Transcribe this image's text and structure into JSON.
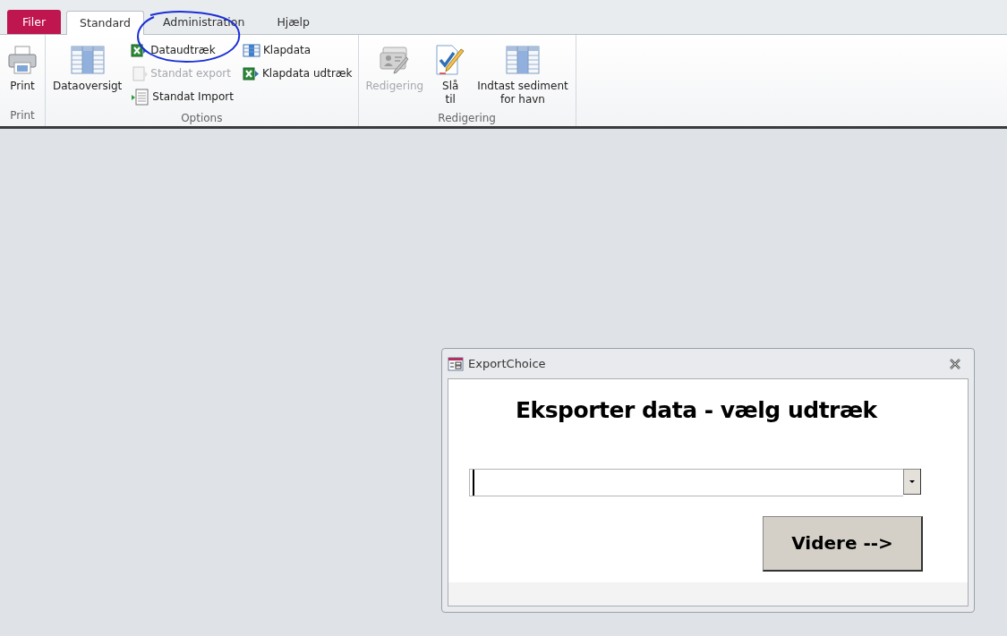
{
  "tabs": [
    {
      "label": "Filer",
      "kind": "file",
      "selected": false
    },
    {
      "label": "Standard",
      "kind": "tab",
      "selected": true
    },
    {
      "label": "Administration",
      "kind": "tab",
      "selected": false
    },
    {
      "label": "Hjælp",
      "kind": "tab",
      "selected": false
    }
  ],
  "ribbon_groups": [
    {
      "label": "Print",
      "items": [
        {
          "label": "Print",
          "kind": "large",
          "disabled": false
        }
      ]
    },
    {
      "label": "Options",
      "items": [
        {
          "label": "Dataoversigt",
          "kind": "large",
          "disabled": false
        },
        {
          "label": "Dataudtræk",
          "kind": "small",
          "disabled": false
        },
        {
          "label": "Standat export",
          "kind": "small",
          "disabled": true
        },
        {
          "label": "Standat Import",
          "kind": "small",
          "disabled": false
        },
        {
          "label": "Klapdata",
          "kind": "small",
          "disabled": false
        },
        {
          "label": "Klapdata udtræk",
          "kind": "small",
          "disabled": false
        }
      ]
    },
    {
      "label": "Redigering",
      "items": [
        {
          "label": "Redigering",
          "kind": "large",
          "disabled": true
        },
        {
          "label": "Slå\ntil",
          "kind": "large",
          "disabled": false
        },
        {
          "label": "Indtast sediment\nfor havn",
          "kind": "large",
          "disabled": false
        }
      ]
    }
  ],
  "dialog": {
    "title": "ExportChoice",
    "heading": "Eksporter data - vælg udtræk",
    "button": "Videre -->"
  }
}
